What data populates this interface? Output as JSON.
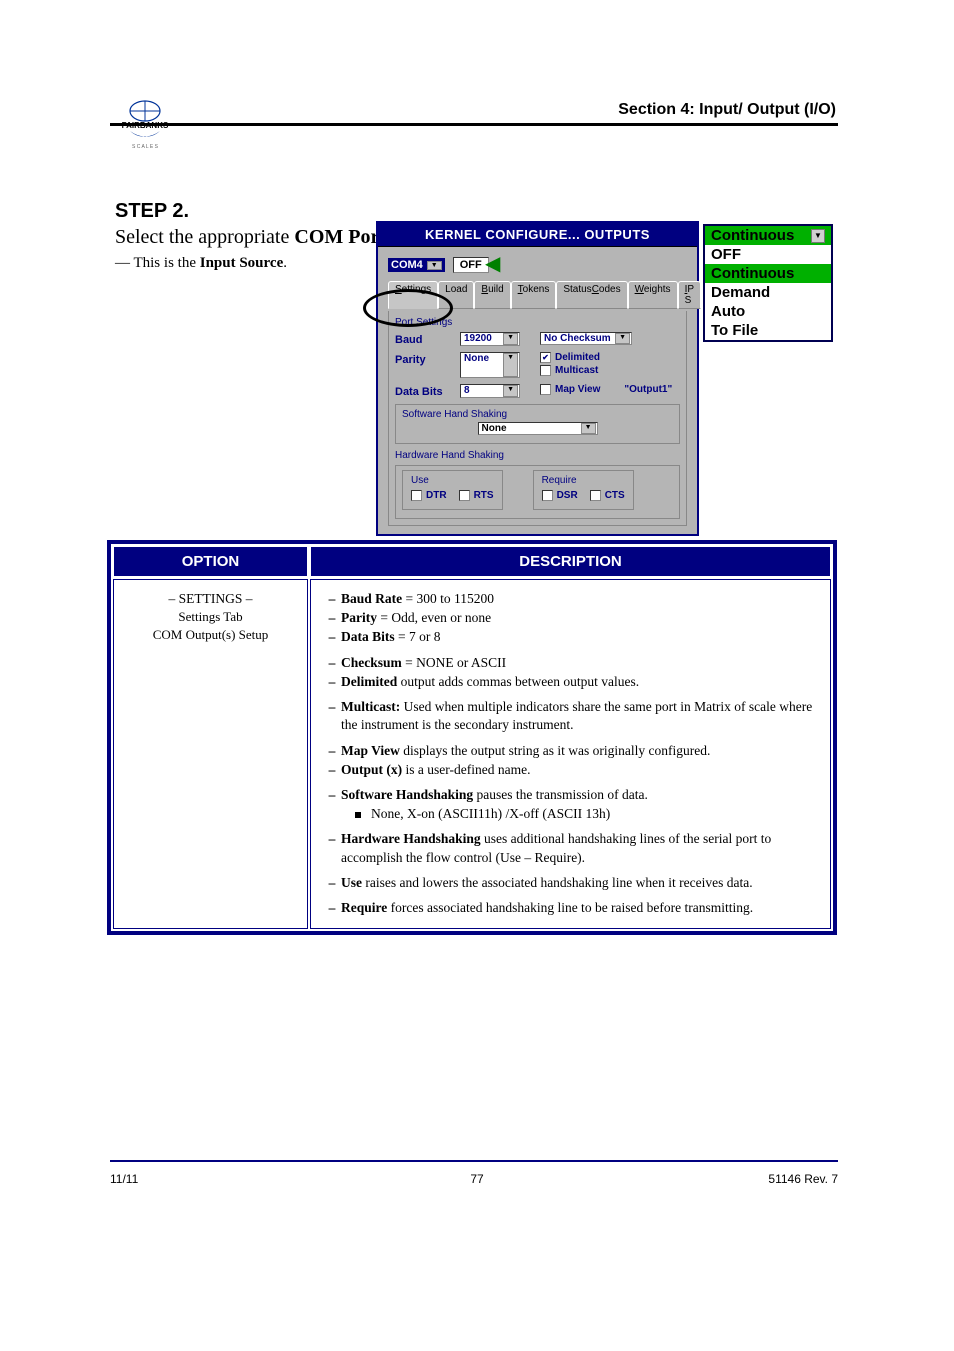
{
  "header": {
    "section_title": "Section 4: Input/ Output (I/O)"
  },
  "step": {
    "label": "STEP 2.",
    "line1_pre": "Select the appropriate ",
    "line1_bold": "COM Port",
    "line1_post": ".",
    "sub_pre": "— This is the ",
    "sub_bold": "Input Source",
    "sub_post": "."
  },
  "dropdown": {
    "selected": "Continuous",
    "items": [
      "OFF",
      "Continuous",
      "Demand",
      "Auto",
      "To File"
    ]
  },
  "dialog": {
    "title": "KERNEL CONFIGURE... OUTPUTS",
    "com_label": "COM4",
    "off_value": "OFF",
    "tabs": [
      "Settings",
      "Load",
      "Build",
      "Tokens",
      "StatusCodes",
      "Weights",
      "IP S"
    ],
    "port_settings_label": "Port Settings",
    "baud_label": "Baud",
    "baud_value": "19200",
    "parity_label": "Parity",
    "parity_value": "None",
    "databits_label": "Data Bits",
    "databits_value": "8",
    "checksum_value": "No Checksum",
    "delimited_label": "Delimited",
    "multicast_label": "Multicast",
    "mapview_label": "Map View",
    "output_name": "\"Output1\"",
    "sw_label": "Software Hand Shaking",
    "sw_value": "None",
    "hw_label": "Hardware Hand Shaking",
    "use_label": "Use",
    "require_label": "Require",
    "dtr": "DTR",
    "rts": "RTS",
    "dsr": "DSR",
    "cts": "CTS"
  },
  "table": {
    "head_option": "OPTION",
    "head_desc": "DESCRIPTION",
    "row_left_main": "– SETTINGS –",
    "row_left_1": "Settings Tab",
    "row_left_2": "COM Output(s) Setup",
    "rows": [
      {
        "b": "Baud Rate",
        "t": " = 300 to 115200"
      },
      {
        "b": "Parity",
        "t": " = Odd, even or none"
      },
      {
        "b": "Data Bits",
        "t": " = 7 or 8"
      },
      null,
      {
        "b": "Checksum ",
        "t": " = NONE or ASCII"
      },
      {
        "b": "Delimited ",
        "t": " output adds commas between output values."
      },
      null,
      {
        "b": "Multicast: ",
        "t": " Used when multiple indicators share the same port in Matrix of scale where the instrument is the secondary instrument."
      },
      null,
      {
        "b": "Map View",
        "t": " displays the output string as it was originally configured."
      },
      {
        "b": "Output (x)",
        "t": " is a user-defined name."
      },
      null,
      {
        "b": "Software Handshaking",
        "t": " pauses the transmission of data."
      },
      {
        "sub": true,
        "t": "None, X-on (ASCII11h) /X-off (ASCII 13h)"
      },
      null,
      {
        "b": "Hardware Handshaking ",
        "t": "uses additional handshaking lines of the serial port to accomplish the flow control (Use – Require)."
      },
      null,
      {
        "b": "Use",
        "t": " raises and lowers the associated handshaking line when it receives data."
      },
      null,
      {
        "b": "Require",
        "t": " forces associated handshaking line to be raised before transmitting."
      }
    ]
  },
  "footer": {
    "left": "11/11",
    "center": "77",
    "right": "51146 Rev. 7"
  }
}
